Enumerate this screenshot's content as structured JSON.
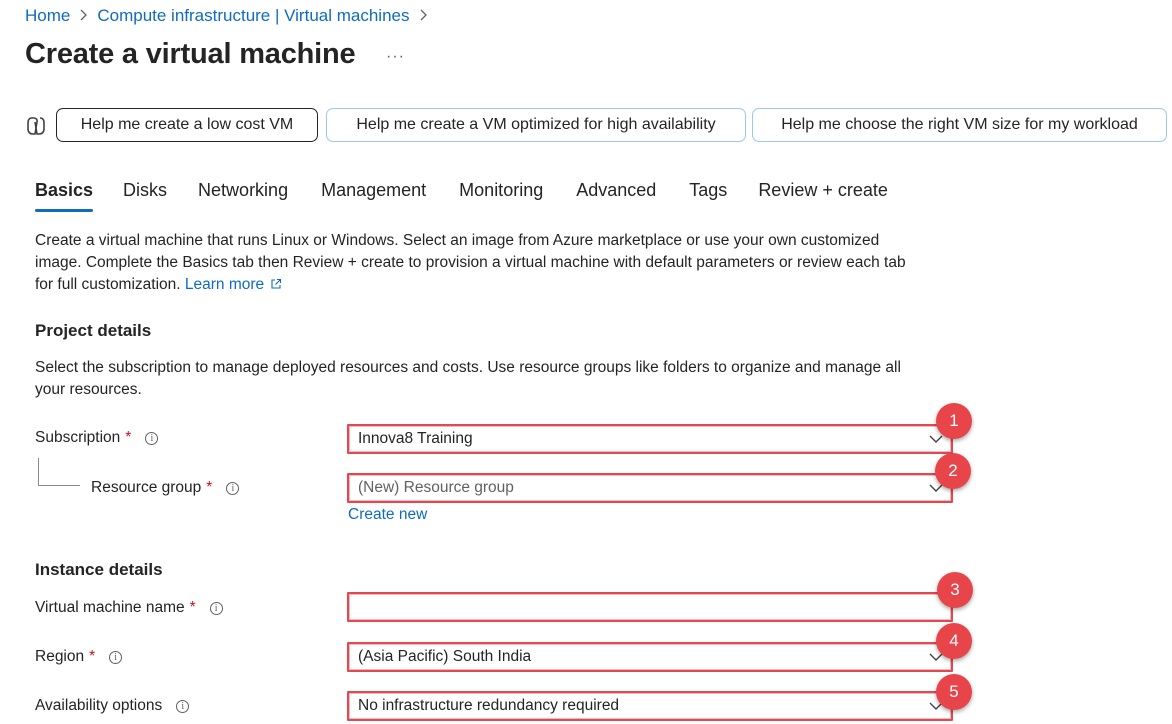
{
  "breadcrumb": {
    "items": [
      "Home",
      "Compute infrastructure | Virtual machines"
    ],
    "separator": ">"
  },
  "page": {
    "title": "Create a virtual machine",
    "more": "···"
  },
  "copilot": {
    "icon": "copilot-icon",
    "chips": [
      "Help me create a low cost VM",
      "Help me create a VM optimized for high availability",
      "Help me choose the right VM size for my workload"
    ]
  },
  "tabs": [
    "Basics",
    "Disks",
    "Networking",
    "Management",
    "Monitoring",
    "Advanced",
    "Tags",
    "Review + create"
  ],
  "active_tab": "Basics",
  "intro": {
    "line1": "Create a virtual machine that runs Linux or Windows. Select an image from Azure marketplace or use your own customized",
    "line2": "image. Complete the Basics tab then Review + create to provision a virtual machine with default parameters or review each tab",
    "line3": "for full customization.",
    "learn_more": "Learn more"
  },
  "project": {
    "heading": "Project details",
    "line1": "Select the subscription to manage deployed resources and costs. Use resource groups like folders to organize and manage all",
    "line2": "your resources."
  },
  "fields": {
    "subscription": {
      "label": "Subscription",
      "value": "Innova8 Training",
      "badge": "1"
    },
    "resource_group": {
      "label": "Resource group",
      "value": "(New) Resource group",
      "badge": "2",
      "create_new": "Create new"
    },
    "vm_name": {
      "label": "Virtual machine name",
      "value": "",
      "badge": "3"
    },
    "region": {
      "label": "Region",
      "value": "(Asia Pacific) South India",
      "badge": "4"
    },
    "availability": {
      "label": "Availability options",
      "value": "No infrastructure redundancy required",
      "badge": "5"
    }
  },
  "instance": {
    "heading": "Instance details"
  },
  "common": {
    "required_mark": "*",
    "info_glyph": "i"
  },
  "colors": {
    "accent": "#0f6cbd",
    "highlight": "#e34850",
    "badge": "#e8454b",
    "required": "#c50f1f"
  }
}
